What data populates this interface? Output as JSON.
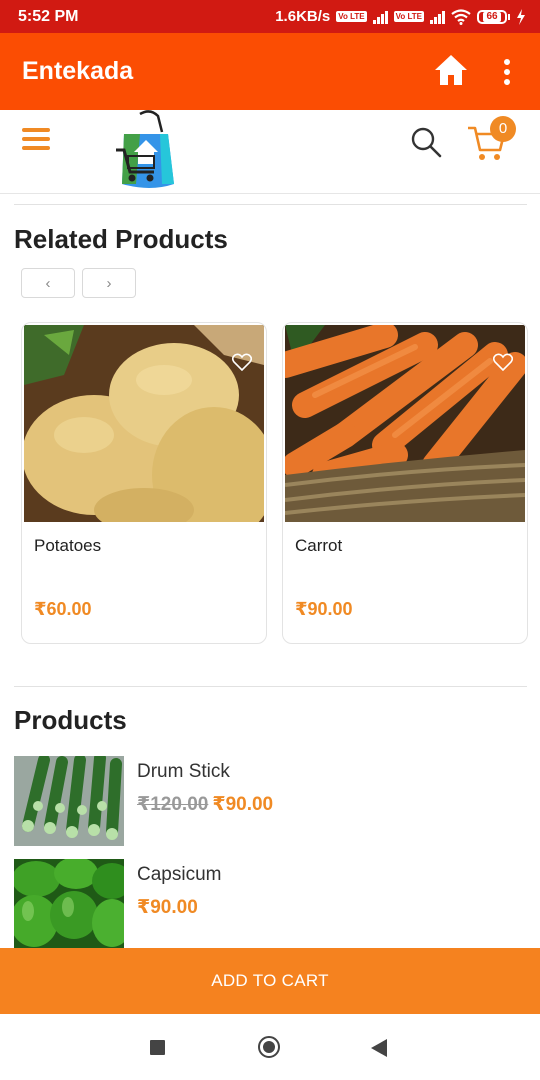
{
  "status_bar": {
    "time": "5:52 PM",
    "network_speed": "1.6KB/s",
    "volte_label": "Vo LTE",
    "network_type": "4G",
    "battery_level": "66"
  },
  "app_bar": {
    "title": "Entekada",
    "icons": [
      "home-icon",
      "more-vert-icon"
    ]
  },
  "header": {
    "icons": [
      "menu-icon",
      "logo",
      "search-icon",
      "cart-icon"
    ],
    "cart_count": "0"
  },
  "related": {
    "title": "Related Products",
    "prev_label": "‹",
    "next_label": "›",
    "items": [
      {
        "name": "Potatoes",
        "price": "₹60.00",
        "image": "potatoes"
      },
      {
        "name": "Carrot",
        "price": "₹90.00",
        "image": "carrots"
      }
    ]
  },
  "products": {
    "title": "Products",
    "items": [
      {
        "name": "Drum Stick",
        "old_price": "₹120.00",
        "price": "₹90.00",
        "image": "drumstick"
      },
      {
        "name": "Capsicum",
        "old_price": "",
        "price": "₹90.00",
        "image": "capsicum"
      }
    ]
  },
  "add_to_cart": {
    "label": "ADD TO CART"
  },
  "colors": {
    "status_bar": "#d11a12",
    "app_bar": "#fb4d03",
    "accent": "#f08a24",
    "button": "#f5821f"
  }
}
